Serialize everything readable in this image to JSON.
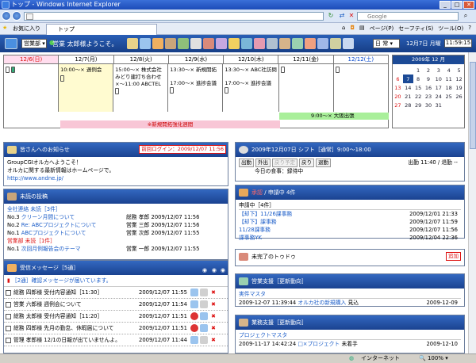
{
  "browser": {
    "title": "トップ - Windows Internet Explorer",
    "search_placeholder": "Google",
    "favorites": "お気に入り",
    "tab": "トップ",
    "menu": [
      "ページ(P)",
      "セーフティ(S)",
      "ツール(O)"
    ],
    "status_zone": "インターネット",
    "status_zoom": "100%"
  },
  "app": {
    "dept": "営業部",
    "user": "営業 太郎様ようこそ。",
    "view_select": "日 常",
    "date": "12月7日 月曜",
    "clock": "11:59:15"
  },
  "calendar": {
    "days": [
      "12/6(日)",
      "12/7(月)",
      "12/8(火)",
      "12/9(水)",
      "12/10(木)",
      "12/11(金)",
      "12/12(土)"
    ],
    "events": {
      "mon": [
        "10:00～× 週例会"
      ],
      "tue": [
        "15:00～× 株式会社",
        "みどり建打ち合わせ",
        "×～11:00 ABCTEL"
      ],
      "wed": [
        "13:30～× 新規開拓",
        "17:00～× 進捗会議"
      ],
      "thu": [
        "13:30～× ABC社訪問",
        "17:00～× 進捗会議"
      ]
    },
    "green_event": "9:00～× 大阪出張",
    "pink_event": "※新規開拓強化週間"
  },
  "minical": {
    "title": "2009年 12 月",
    "weeks": [
      [
        "",
        "",
        "1",
        "2",
        "3",
        "4",
        "5"
      ],
      [
        "6",
        "7",
        "8",
        "9",
        "10",
        "11",
        "12"
      ],
      [
        "13",
        "14",
        "15",
        "16",
        "17",
        "18",
        "19"
      ],
      [
        "20",
        "21",
        "22",
        "23",
        "24",
        "25",
        "26"
      ],
      [
        "27",
        "28",
        "29",
        "30",
        "31",
        "",
        ""
      ]
    ],
    "today": "7"
  },
  "notice": {
    "title": "皆さんへのお知らせ",
    "badge": "前回ログイン：2009/12/07 11:56",
    "lines": [
      "GroupCGIオルカへようこそ！",
      "オルカに関する最新情報はホームページで。",
      "http://www.andne.jp/"
    ]
  },
  "posts": {
    "title": "未読の投稿",
    "group1": "全社連絡 未読［3件］",
    "rows1": [
      {
        "no": "No.3",
        "text": "クリーン月間について",
        "author": "総務 孝郎",
        "date": "2009/12/07 11:56"
      },
      {
        "no": "No.2",
        "text": "Re: ABCプロジェクトについて",
        "author": "営業 三郎",
        "date": "2009/12/07 11:56"
      },
      {
        "no": "No.1",
        "text": "ABCプロジェクトについて",
        "author": "営業 次郎",
        "date": "2009/12/07 11:55"
      }
    ],
    "group2": "営業部 未読［1件］",
    "rows2": [
      {
        "no": "No.1",
        "text": "次回月例報告会のテーマ",
        "author": "営業 一郎",
        "date": "2009/12/07 11:55"
      }
    ]
  },
  "messages": {
    "title": "受信メッセージ［5通］",
    "confirm": "［2通］確認メッセージが届いています。",
    "rows": [
      {
        "text": "総務 四郎様 受付内容通知［11:30］",
        "date": "2009/12/07 11:55"
      },
      {
        "text": "営業 六郎様 週例会について",
        "date": "2009/12/07 11:54"
      },
      {
        "text": "総務 太郎様 受付内容通知［11:20］",
        "date": "2009/12/07 11:51"
      },
      {
        "text": "総務 四郎様 先月の勤怠、休暇届について",
        "date": "2009/12/07 11:51"
      },
      {
        "text": "管理 孝郎様 12/1の日報が出ていませんよ。",
        "date": "2009/12/07 11:44"
      }
    ]
  },
  "attendance": {
    "title": "2009年12月07日  シフト［通常］9:00～18:00",
    "buttons": [
      "出勤",
      "外出",
      "戻り予定",
      "戻り",
      "退勤"
    ],
    "status": "出勤 11:40 / 退勤 --",
    "meal": "今日の食事：録待中"
  },
  "requests": {
    "title": "申請中 4件",
    "title_prefix": "承認",
    "sub": "申請中［4件］",
    "rows": [
      {
        "text": "【却下】11/26課事務",
        "date": "2009/12/01 21:33"
      },
      {
        "text": "【却下】課事務",
        "date": "2009/12/07 11:59"
      },
      {
        "text": "11/28課事務",
        "date": "2009/12/07 11:56"
      },
      {
        "text": "課事務YK",
        "date": "2009/12/04 22:36"
      }
    ]
  },
  "todo": {
    "title": "未完了のトゥドゥ",
    "add": "追加"
  },
  "support1": {
    "title": "営業支援［更新動向］",
    "link": "実件マスタ",
    "row": {
      "date": "2009-12-07 11:39:44",
      "text": "オルカ社の新規購入",
      "status": "見込",
      "due": "2009-12-09"
    }
  },
  "support2": {
    "title": "業務支援［更新動向］",
    "link": "プロジェクトマスタ",
    "row": {
      "date": "2009-11-17 14:42:24",
      "text": "□×プロジェクト",
      "status": "未着手",
      "due": "2009-12-10"
    }
  }
}
